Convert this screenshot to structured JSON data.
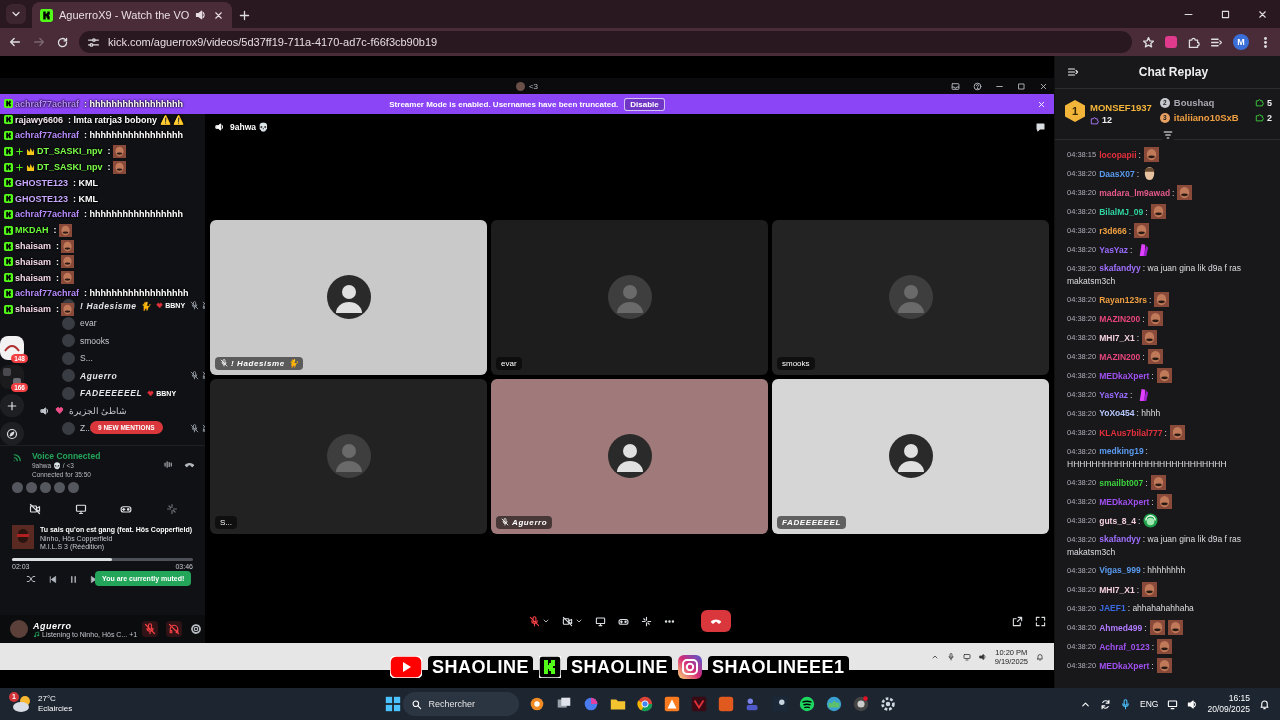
{
  "browser": {
    "tabs": [
      {
        "title": "AguerroX9 - Watch the VO",
        "selected": true,
        "audio": true
      }
    ],
    "url": "kick.com/aguerrox9/videos/5d37ff19-711a-4170-ad7c-f66f3cb90b19",
    "profile": "M"
  },
  "overlay_chat": [
    {
      "user": "achraf77achraf",
      "color": "#b98cff",
      "badges": [
        {
          "kind": "kick"
        }
      ],
      "message": ": hhhhhhhhhhhhhhhhh"
    },
    {
      "user": "rajawy6606",
      "color": "#f2e6ee",
      "badges": [
        {
          "kind": "kick"
        }
      ],
      "message": ": lmta ratrja3 bobony ⚠️ ⚠️"
    },
    {
      "user": "achraf77achraf",
      "color": "#b98cff",
      "badges": [
        {
          "kind": "kick"
        }
      ],
      "message": ": hhhhhhhhhhhhhhhhh"
    },
    {
      "user": "DT_SASKI_npv",
      "color": "#7dff4a",
      "badges": [
        {
          "kind": "kick"
        },
        {
          "kind": "plus"
        },
        {
          "kind": "crown"
        }
      ],
      "message": ":",
      "emotes": [
        {
          "kind": "face"
        }
      ]
    },
    {
      "user": "DT_SASKI_npv",
      "color": "#7dff4a",
      "badges": [
        {
          "kind": "kick"
        },
        {
          "kind": "plus"
        },
        {
          "kind": "crown"
        }
      ],
      "message": ":",
      "emotes": [
        {
          "kind": "face"
        }
      ]
    },
    {
      "user": "GHOSTE123",
      "color": "#c9a8ff",
      "badges": [
        {
          "kind": "kick"
        }
      ],
      "message": ": KML"
    },
    {
      "user": "GHOSTE123",
      "color": "#c9a8ff",
      "badges": [
        {
          "kind": "kick"
        }
      ],
      "message": ": KML"
    },
    {
      "user": "achraf77achraf",
      "color": "#b98cff",
      "badges": [
        {
          "kind": "kick"
        }
      ],
      "message": ": hhhhhhhhhhhhhhhhh"
    },
    {
      "user": "MKDAH",
      "color": "#6bff3a",
      "badges": [
        {
          "kind": "kick"
        }
      ],
      "message": ":",
      "emotes": [
        {
          "kind": "face"
        }
      ]
    },
    {
      "user": "shaisam",
      "color": "#f4d8e8",
      "badges": [
        {
          "kind": "kick"
        }
      ],
      "message": ":",
      "emotes": [
        {
          "kind": "face"
        }
      ]
    },
    {
      "user": "shaisam",
      "color": "#f4d8e8",
      "badges": [
        {
          "kind": "kick"
        }
      ],
      "message": ":",
      "emotes": [
        {
          "kind": "face"
        }
      ]
    },
    {
      "user": "shaisam",
      "color": "#f4d8e8",
      "badges": [
        {
          "kind": "kick"
        }
      ],
      "message": ":",
      "emotes": [
        {
          "kind": "face"
        }
      ]
    },
    {
      "user": "achraf77achraf",
      "color": "#b98cff",
      "badges": [
        {
          "kind": "kick"
        }
      ],
      "message": ": hhhhhhhhhhhhhhhhhh"
    },
    {
      "user": "shaisam",
      "color": "#f4d8e8",
      "badges": [
        {
          "kind": "kick"
        }
      ],
      "message": ":",
      "emotes": [
        {
          "kind": "face"
        }
      ]
    }
  ],
  "discord": {
    "title": "<3",
    "banner": {
      "text": "Streamer Mode is enabled. Usernames have been truncated.",
      "button": "Disable"
    },
    "servers": [
      {
        "badge": "148"
      },
      {
        "badge": "166"
      }
    ],
    "members": [
      {
        "kind": "member",
        "name": "! Hadesisme 🐈",
        "tag": "BBNY",
        "styled": true,
        "muted": true
      },
      {
        "kind": "member",
        "name": "evar",
        "styled": false,
        "muted": false
      },
      {
        "kind": "member",
        "name": "smooks",
        "styled": false,
        "muted": false
      },
      {
        "kind": "member",
        "name": "S...",
        "styled": false,
        "muted": false
      },
      {
        "kind": "member",
        "name": "Aguerro",
        "styled": true,
        "muted": true
      },
      {
        "kind": "member",
        "name": "FADEEEEEEL",
        "tag": "BBNY",
        "styled": true,
        "muted": false
      },
      {
        "kind": "channel",
        "name": "شاطئ الجزيرة",
        "styled": false,
        "muted": false
      },
      {
        "kind": "member",
        "name": "Z...",
        "styled": false,
        "muted": true
      }
    ],
    "mentions": "9 NEW MENTIONS",
    "voice": {
      "status": "Voice Connected",
      "channel": "9ahwa 💀 / <3",
      "duration": "Connected for 35:50"
    },
    "song": {
      "title": "Tu sais qu'on est gang (feat. Hös Copperfield)",
      "artist": "Ninho, Hös Copperfield",
      "album": "M.I.L.S 3 (Réédition)",
      "elapsed": "02:03",
      "total": "03:46",
      "level": 0.55
    },
    "toast": "You are currently muted!",
    "user": {
      "name": "Aguerro",
      "activity": "Listening to Ninho, Hös C... +1",
      "mic_muted": true,
      "deafened": true
    },
    "channel": "9ahwa 💀",
    "tiles": [
      {
        "name": "! Hadesisme 🐈",
        "color": "#c9c9c9",
        "styled": true,
        "muted": true
      },
      {
        "name": "evar",
        "color": "#1d1d1d",
        "styled": false,
        "muted": false
      },
      {
        "name": "smooks",
        "color": "#232323",
        "styled": false,
        "muted": false
      },
      {
        "name": "S...",
        "color": "#222222",
        "styled": false,
        "muted": false
      },
      {
        "name": "Aguerro",
        "color": "#a07a7a",
        "styled": true,
        "muted": true
      },
      {
        "name": "FADEEEEEEL",
        "color": "#d6d6d6",
        "styled": true,
        "muted": false
      }
    ],
    "call_controls": {
      "mic_muted": true
    }
  },
  "inner_taskbar": {
    "time": "10:20 PM",
    "date": "9/19/2025"
  },
  "social": [
    {
      "kind": "youtube",
      "handle": "SHAOLINE"
    },
    {
      "kind": "kick",
      "handle": "SHAOLINE"
    },
    {
      "kind": "instagram",
      "handle": "SHAOLINEEE1"
    }
  ],
  "chat_replay": {
    "title": "Chat Replay",
    "leaders": [
      {
        "rank": "1",
        "name": "MONSEF1937",
        "count": "12",
        "color": "#f3b43a"
      },
      {
        "rank": "2",
        "name": "Boushaq",
        "count": "5",
        "color": "#a8a8b0"
      },
      {
        "rank": "3",
        "name": "italiiano10SxB",
        "count": "2",
        "color": "#f0a040"
      }
    ],
    "messages": [
      {
        "time": "04:38:15",
        "user": "locopapii",
        "color": "#e5303c",
        "text": ":",
        "emotes": [
          {
            "kind": "face"
          }
        ]
      },
      {
        "time": "04:38:20",
        "user": "DaasX07",
        "color": "#5a9bf0",
        "text": ":",
        "emotes": [
          {
            "kind": "portrait"
          }
        ]
      },
      {
        "time": "04:38:20",
        "user": "madara_lm9awad",
        "color": "#e65a8a",
        "text": ":",
        "emotes": [
          {
            "kind": "face"
          }
        ]
      },
      {
        "time": "04:38:20",
        "user": "BilalMJ_09",
        "color": "#2fd4a0",
        "text": ":",
        "emotes": [
          {
            "kind": "face"
          }
        ]
      },
      {
        "time": "04:38:20",
        "user": "r3d666",
        "color": "#f0a040",
        "text": ":",
        "emotes": [
          {
            "kind": "face"
          }
        ]
      },
      {
        "time": "04:38:20",
        "user": "YasYaz",
        "color": "#9b6bff",
        "text": ":",
        "emotes": [
          {
            "kind": "pray"
          }
        ]
      },
      {
        "time": "04:38:20",
        "user": "skafandyy",
        "color": "#a070ff",
        "text": ": wa juan gina lik d9a f ras makatsm3ch"
      },
      {
        "time": "04:38:20",
        "user": "Rayan123rs",
        "color": "#f0a040",
        "text": ":",
        "emotes": [
          {
            "kind": "face"
          }
        ]
      },
      {
        "time": "04:38:20",
        "user": "MAZIN200",
        "color": "#e8457a",
        "text": ":",
        "emotes": [
          {
            "kind": "face"
          }
        ]
      },
      {
        "time": "04:38:20",
        "user": "MHI7_X1",
        "color": "#f4d0e0",
        "text": ":",
        "emotes": [
          {
            "kind": "face"
          }
        ]
      },
      {
        "time": "04:38:20",
        "user": "MAZIN200",
        "color": "#e8457a",
        "text": ":",
        "emotes": [
          {
            "kind": "face"
          }
        ]
      },
      {
        "time": "04:38:20",
        "user": "MEDkaXpert",
        "color": "#a050f0",
        "text": ":",
        "emotes": [
          {
            "kind": "face"
          }
        ]
      },
      {
        "time": "04:38:20",
        "user": "YasYaz",
        "color": "#9b6bff",
        "text": ":",
        "emotes": [
          {
            "kind": "pray"
          }
        ]
      },
      {
        "time": "04:38:20",
        "user": "YoXo454",
        "color": "#b7c8ff",
        "text": ": hhhh"
      },
      {
        "time": "04:38:20",
        "user": "KLAus7bilal777",
        "color": "#e5303c",
        "text": ":",
        "emotes": [
          {
            "kind": "face"
          }
        ]
      },
      {
        "time": "04:38:20",
        "user": "medking19",
        "color": "#5a9bf0",
        "text": ": HHHHHHHHHHHHHHHHHHHHHHHHHH"
      },
      {
        "time": "04:38:20",
        "user": "smailbt007",
        "color": "#3dd13d",
        "text": ":",
        "emotes": [
          {
            "kind": "face"
          }
        ]
      },
      {
        "time": "04:38:20",
        "user": "MEDkaXpert",
        "color": "#a050f0",
        "text": ":",
        "emotes": [
          {
            "kind": "face"
          }
        ]
      },
      {
        "time": "04:38:20",
        "user": "guts_8_4",
        "color": "#f4d0e0",
        "text": ":",
        "emotes": [
          {
            "kind": "headset"
          }
        ]
      },
      {
        "time": "04:38:20",
        "user": "skafandyy",
        "color": "#a070ff",
        "text": ": wa juan gina lik d9a f ras makatsm3ch"
      },
      {
        "time": "04:38:20",
        "user": "Vigas_999",
        "color": "#5a9bf0",
        "text": ": hhhhhhhh"
      },
      {
        "time": "04:38:20",
        "user": "MHI7_X1",
        "color": "#f4d0e0",
        "text": ":",
        "emotes": [
          {
            "kind": "face"
          }
        ]
      },
      {
        "time": "04:38:20",
        "user": "JAEF1",
        "color": "#3a6ae0",
        "text": ": ahhahahahhaha"
      },
      {
        "time": "04:38:20",
        "user": "Ahmed499",
        "color": "#b07aff",
        "text": ":",
        "emotes": [
          {
            "kind": "face"
          },
          {
            "kind": "face"
          }
        ]
      },
      {
        "time": "04:38:20",
        "user": "Achraf_0123",
        "color": "#a050f0",
        "text": ":",
        "emotes": [
          {
            "kind": "face"
          }
        ]
      },
      {
        "time": "04:38:20",
        "user": "MEDkaXpert",
        "color": "#a050f0",
        "text": ":",
        "emotes": [
          {
            "kind": "face"
          }
        ]
      }
    ]
  },
  "taskbar": {
    "weather": {
      "temp": "27°C",
      "desc": "Eclaircies",
      "badge": "1"
    },
    "search": {
      "placeholder": "Rechercher"
    },
    "language": "ENG",
    "time": "16:15",
    "date": "20/09/2025"
  }
}
